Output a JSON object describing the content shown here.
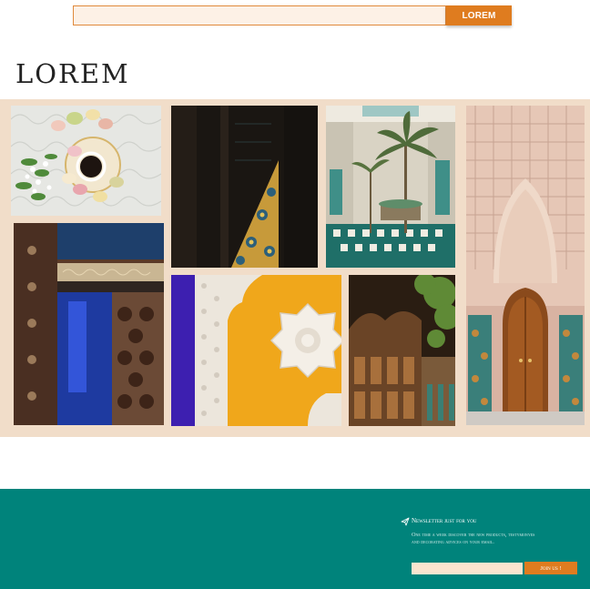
{
  "search": {
    "value": "",
    "placeholder": "",
    "button_label": "LOREM"
  },
  "logo": {
    "text": "LOREM"
  },
  "gallery": {
    "images": [
      {
        "subject": "macarons-and-coffee-photo"
      },
      {
        "subject": "sunlit-zellige-doorway-photo"
      },
      {
        "subject": "riad-courtyard-palms-photo"
      },
      {
        "subject": "carved-arch-wooden-door-photo"
      },
      {
        "subject": "blue-mosaic-wall-photo"
      },
      {
        "subject": "yellow-wall-white-plaster-star-photo"
      },
      {
        "subject": "sunlit-carved-archway-photo"
      }
    ]
  },
  "footer": {
    "newsletter_title": "Newsletter just for you",
    "newsletter_description": "One time a week discover the new products, testymonyes and decorating advices on your email.",
    "email_value": "",
    "email_placeholder": "",
    "join_label": "Join us !",
    "icon": "send-icon"
  },
  "colors": {
    "accent": "#df7c1f",
    "gallery_bg": "#f1ddc9",
    "footer_bg": "#00837b",
    "input_bg": "#fdf1e6"
  }
}
